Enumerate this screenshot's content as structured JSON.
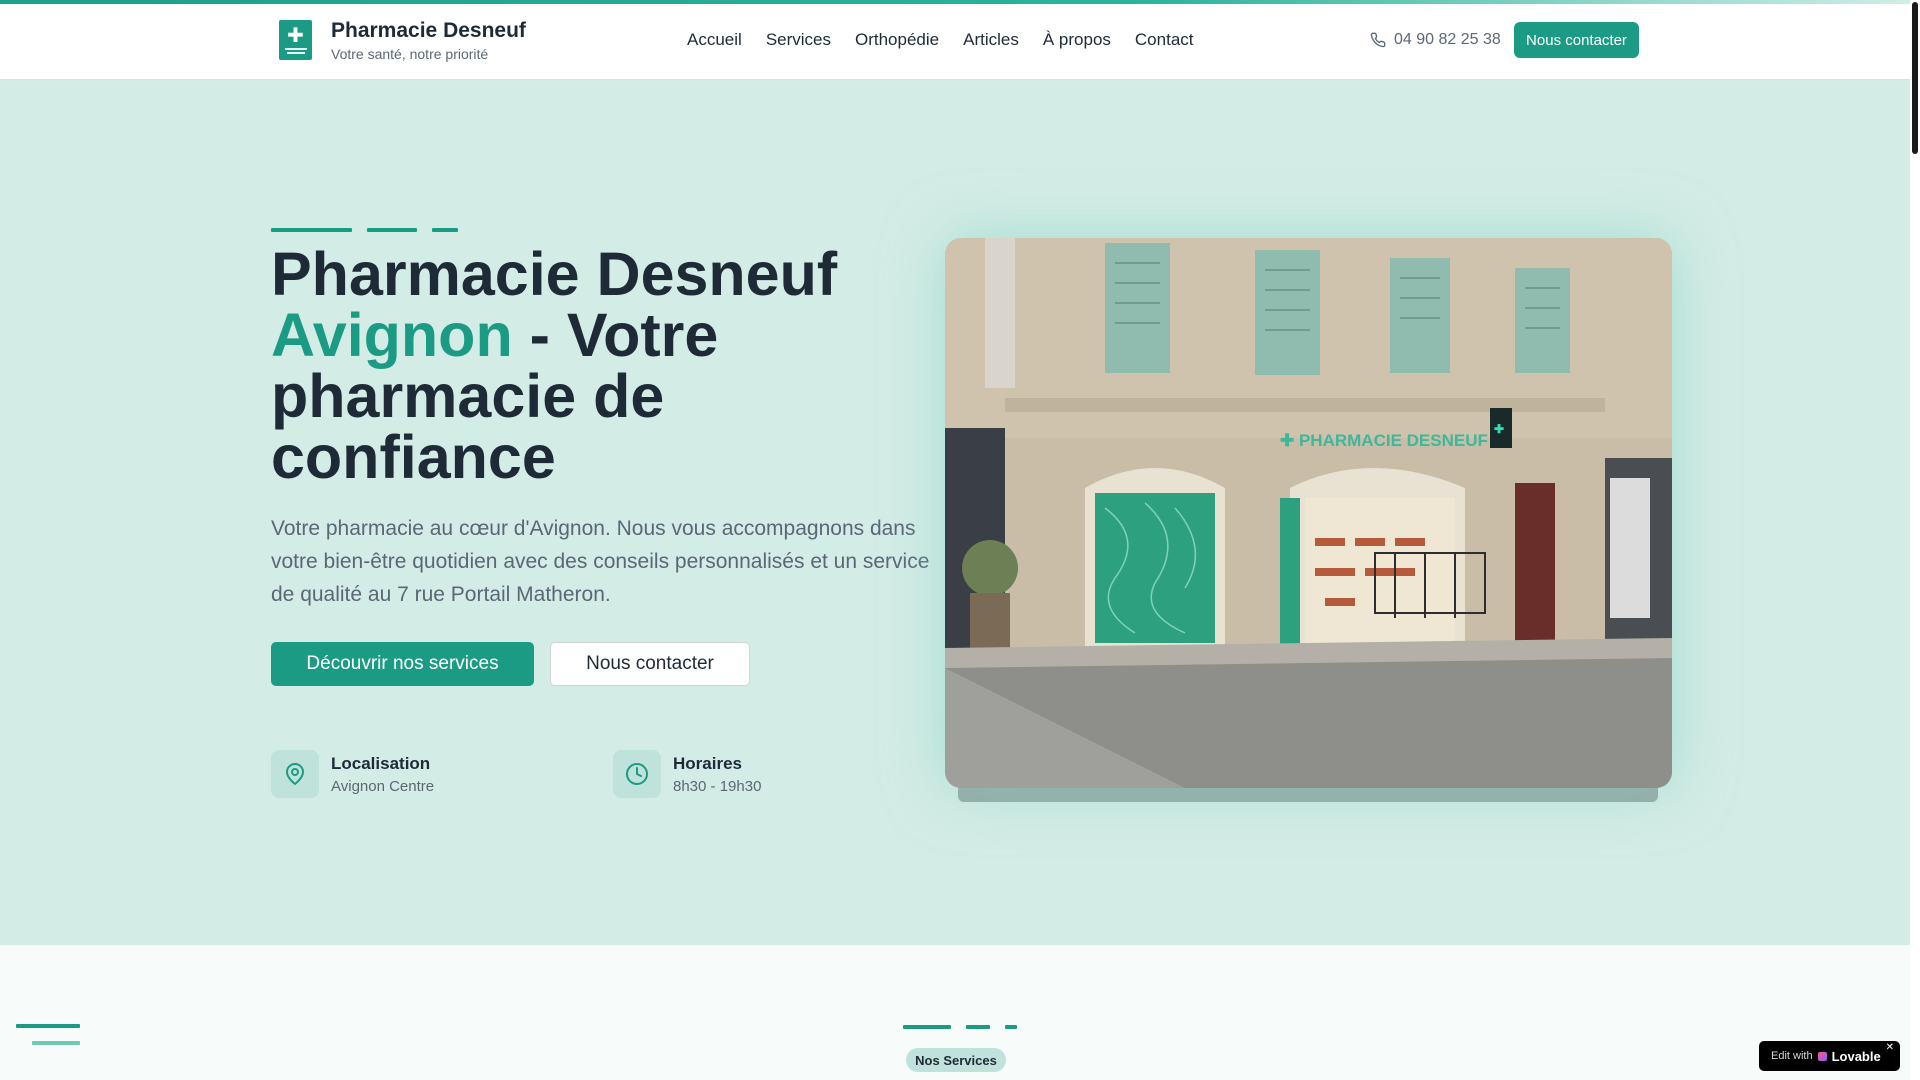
{
  "header": {
    "brand_name": "Pharmacie Desneuf",
    "brand_tagline": "Votre santé, notre priorité",
    "nav": [
      "Accueil",
      "Services",
      "Orthopédie",
      "Articles",
      "À propos",
      "Contact"
    ],
    "phone": "04 90 82 25 38",
    "cta": "Nous contacter"
  },
  "hero": {
    "title_part1": "Pharmacie Desneuf",
    "title_accent": "Avignon",
    "title_part2": " - Votre pharmacie de confiance",
    "description": "Votre pharmacie au cœur d'Avignon. Nous vous accompagnons dans votre bien-être quotidien avec des conseils personnalisés et un service de qualité au 7 rue Portail Matheron.",
    "primary_button": "Découvrir nos services",
    "secondary_button": "Nous contacter",
    "info": [
      {
        "title": "Localisation",
        "value": "Avignon Centre"
      },
      {
        "title": "Horaires",
        "value": "8h30 - 19h30"
      }
    ],
    "photo_sign": "PHARMACIE DESNEUF"
  },
  "services": {
    "badge": "Nos Services"
  },
  "lovable": {
    "prefix": "Edit with",
    "name": "Lovable"
  },
  "colors": {
    "accent": "#1c9b84",
    "hero_bg": "#d4ece6",
    "text_dark": "#1f2a37",
    "text_muted": "#5b6775"
  }
}
